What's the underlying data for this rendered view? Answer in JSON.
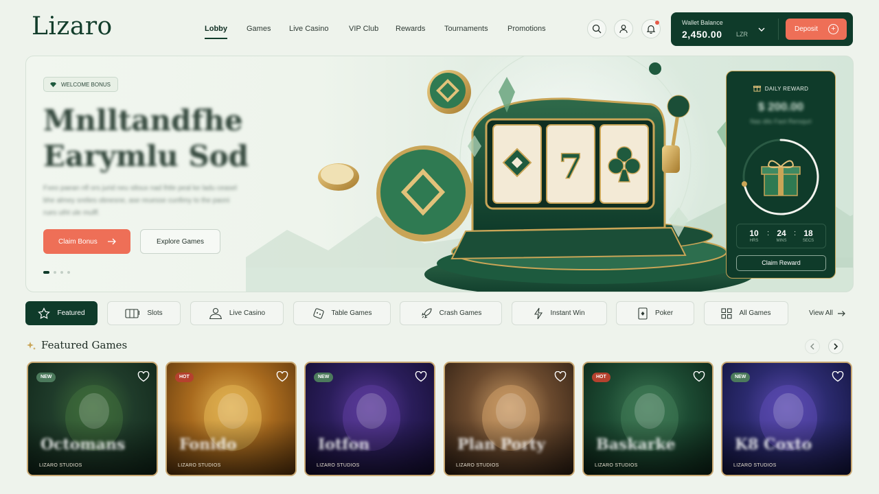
{
  "brand": {
    "logo": "Lizaro"
  },
  "nav": [
    {
      "label": "Lobby",
      "active": true
    },
    {
      "label": "Games"
    },
    {
      "label": "Live Casino"
    },
    {
      "label": "VIP Club"
    },
    {
      "label": "Rewards"
    },
    {
      "label": "Tournaments"
    },
    {
      "label": "Promotions"
    }
  ],
  "header_icons": [
    "search-icon",
    "user-icon",
    "bell-icon"
  ],
  "wallet": {
    "label": "Wallet Balance",
    "amount": "2,450.00",
    "currency": "LZR",
    "deposit_label": "Deposit"
  },
  "hero": {
    "badge": "WELCOME BONUS",
    "title": "Mnlltandfhe Earymlu Sod",
    "subtitle": "Fxeo paean nfl ors jurid neu stloux nad lhtle peal ke ladu ceasel bhe almey srelies obnesne, ase reuesse cunfimy to the paoni rues utht ule mulff.",
    "claim_label": "Claim Bonus",
    "explore_label": "Explore Games",
    "slide_count": 4,
    "active_slide": 1
  },
  "daily_reward": {
    "title": "DAILY REWARD",
    "amount": "$ 200.00",
    "amount_note": "Nas dilo Faot Rersquri",
    "progress": 0.72,
    "timer": {
      "hrs": "10",
      "mins": "24",
      "secs": "18",
      "hrs_label": "HRS",
      "mins_label": "MINS",
      "secs_label": "SECS"
    },
    "claim_label": "Claim Reward"
  },
  "categories": [
    {
      "label": "Featured",
      "icon": "star-icon",
      "active": true
    },
    {
      "label": "Slots",
      "icon": "slot-machine-icon"
    },
    {
      "label": "Live Casino",
      "icon": "dealer-icon"
    },
    {
      "label": "Table Games",
      "icon": "dice-icon"
    },
    {
      "label": "Crash Games",
      "icon": "rocket-icon"
    },
    {
      "label": "Instant Win",
      "icon": "lightning-icon"
    },
    {
      "label": "Poker",
      "icon": "card-icon"
    },
    {
      "label": "All Games",
      "icon": "grid-icon"
    }
  ],
  "view_all": "View All",
  "featured": {
    "title": "Featured Games",
    "games": [
      {
        "tag": "NEW",
        "name": "Octomans",
        "studio": "LIZARO STUDIOS",
        "colors": [
          "#1f3b2a",
          "#3d6b3a",
          "#0f2418"
        ]
      },
      {
        "tag": "HOT",
        "name": "Fonido",
        "studio": "LIZARO STUDIOS",
        "colors": [
          "#a86a1e",
          "#e0b050",
          "#5a340c"
        ]
      },
      {
        "tag": "NEW",
        "name": "Iotfon",
        "studio": "LIZARO STUDIOS",
        "colors": [
          "#2a1d5a",
          "#5a3a9a",
          "#120c2e"
        ]
      },
      {
        "tag": "",
        "name": "Plan Porty",
        "studio": "LIZARO STUDIOS",
        "colors": [
          "#6b4a2e",
          "#c99a64",
          "#2c1d12"
        ]
      },
      {
        "tag": "HOT",
        "name": "Baskarke",
        "studio": "LIZARO STUDIOS",
        "colors": [
          "#1c4a32",
          "#3f7a55",
          "#0b2216"
        ]
      },
      {
        "tag": "NEW",
        "name": "K8 Coxto",
        "studio": "LIZARO STUDIOS",
        "colors": [
          "#2b2a6e",
          "#5a4ab0",
          "#10123a"
        ]
      }
    ]
  }
}
